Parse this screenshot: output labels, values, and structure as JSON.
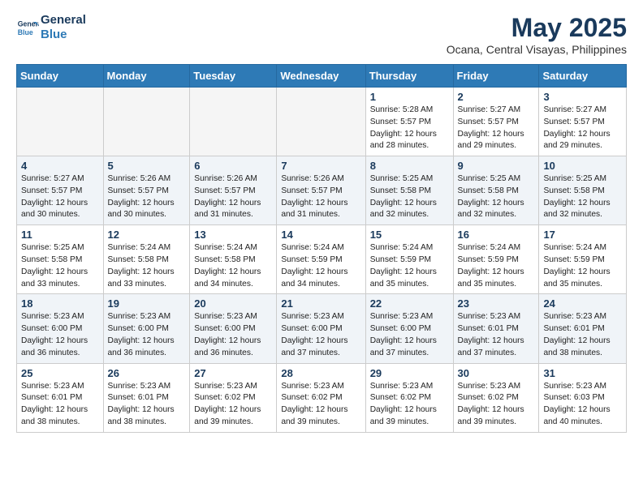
{
  "header": {
    "logo_line1": "General",
    "logo_line2": "Blue",
    "month_title": "May 2025",
    "subtitle": "Ocana, Central Visayas, Philippines"
  },
  "weekdays": [
    "Sunday",
    "Monday",
    "Tuesday",
    "Wednesday",
    "Thursday",
    "Friday",
    "Saturday"
  ],
  "weeks": [
    [
      {
        "day": "",
        "info": ""
      },
      {
        "day": "",
        "info": ""
      },
      {
        "day": "",
        "info": ""
      },
      {
        "day": "",
        "info": ""
      },
      {
        "day": "1",
        "info": "Sunrise: 5:28 AM\nSunset: 5:57 PM\nDaylight: 12 hours\nand 28 minutes."
      },
      {
        "day": "2",
        "info": "Sunrise: 5:27 AM\nSunset: 5:57 PM\nDaylight: 12 hours\nand 29 minutes."
      },
      {
        "day": "3",
        "info": "Sunrise: 5:27 AM\nSunset: 5:57 PM\nDaylight: 12 hours\nand 29 minutes."
      }
    ],
    [
      {
        "day": "4",
        "info": "Sunrise: 5:27 AM\nSunset: 5:57 PM\nDaylight: 12 hours\nand 30 minutes."
      },
      {
        "day": "5",
        "info": "Sunrise: 5:26 AM\nSunset: 5:57 PM\nDaylight: 12 hours\nand 30 minutes."
      },
      {
        "day": "6",
        "info": "Sunrise: 5:26 AM\nSunset: 5:57 PM\nDaylight: 12 hours\nand 31 minutes."
      },
      {
        "day": "7",
        "info": "Sunrise: 5:26 AM\nSunset: 5:57 PM\nDaylight: 12 hours\nand 31 minutes."
      },
      {
        "day": "8",
        "info": "Sunrise: 5:25 AM\nSunset: 5:58 PM\nDaylight: 12 hours\nand 32 minutes."
      },
      {
        "day": "9",
        "info": "Sunrise: 5:25 AM\nSunset: 5:58 PM\nDaylight: 12 hours\nand 32 minutes."
      },
      {
        "day": "10",
        "info": "Sunrise: 5:25 AM\nSunset: 5:58 PM\nDaylight: 12 hours\nand 32 minutes."
      }
    ],
    [
      {
        "day": "11",
        "info": "Sunrise: 5:25 AM\nSunset: 5:58 PM\nDaylight: 12 hours\nand 33 minutes."
      },
      {
        "day": "12",
        "info": "Sunrise: 5:24 AM\nSunset: 5:58 PM\nDaylight: 12 hours\nand 33 minutes."
      },
      {
        "day": "13",
        "info": "Sunrise: 5:24 AM\nSunset: 5:58 PM\nDaylight: 12 hours\nand 34 minutes."
      },
      {
        "day": "14",
        "info": "Sunrise: 5:24 AM\nSunset: 5:59 PM\nDaylight: 12 hours\nand 34 minutes."
      },
      {
        "day": "15",
        "info": "Sunrise: 5:24 AM\nSunset: 5:59 PM\nDaylight: 12 hours\nand 35 minutes."
      },
      {
        "day": "16",
        "info": "Sunrise: 5:24 AM\nSunset: 5:59 PM\nDaylight: 12 hours\nand 35 minutes."
      },
      {
        "day": "17",
        "info": "Sunrise: 5:24 AM\nSunset: 5:59 PM\nDaylight: 12 hours\nand 35 minutes."
      }
    ],
    [
      {
        "day": "18",
        "info": "Sunrise: 5:23 AM\nSunset: 6:00 PM\nDaylight: 12 hours\nand 36 minutes."
      },
      {
        "day": "19",
        "info": "Sunrise: 5:23 AM\nSunset: 6:00 PM\nDaylight: 12 hours\nand 36 minutes."
      },
      {
        "day": "20",
        "info": "Sunrise: 5:23 AM\nSunset: 6:00 PM\nDaylight: 12 hours\nand 36 minutes."
      },
      {
        "day": "21",
        "info": "Sunrise: 5:23 AM\nSunset: 6:00 PM\nDaylight: 12 hours\nand 37 minutes."
      },
      {
        "day": "22",
        "info": "Sunrise: 5:23 AM\nSunset: 6:00 PM\nDaylight: 12 hours\nand 37 minutes."
      },
      {
        "day": "23",
        "info": "Sunrise: 5:23 AM\nSunset: 6:01 PM\nDaylight: 12 hours\nand 37 minutes."
      },
      {
        "day": "24",
        "info": "Sunrise: 5:23 AM\nSunset: 6:01 PM\nDaylight: 12 hours\nand 38 minutes."
      }
    ],
    [
      {
        "day": "25",
        "info": "Sunrise: 5:23 AM\nSunset: 6:01 PM\nDaylight: 12 hours\nand 38 minutes."
      },
      {
        "day": "26",
        "info": "Sunrise: 5:23 AM\nSunset: 6:01 PM\nDaylight: 12 hours\nand 38 minutes."
      },
      {
        "day": "27",
        "info": "Sunrise: 5:23 AM\nSunset: 6:02 PM\nDaylight: 12 hours\nand 39 minutes."
      },
      {
        "day": "28",
        "info": "Sunrise: 5:23 AM\nSunset: 6:02 PM\nDaylight: 12 hours\nand 39 minutes."
      },
      {
        "day": "29",
        "info": "Sunrise: 5:23 AM\nSunset: 6:02 PM\nDaylight: 12 hours\nand 39 minutes."
      },
      {
        "day": "30",
        "info": "Sunrise: 5:23 AM\nSunset: 6:02 PM\nDaylight: 12 hours\nand 39 minutes."
      },
      {
        "day": "31",
        "info": "Sunrise: 5:23 AM\nSunset: 6:03 PM\nDaylight: 12 hours\nand 40 minutes."
      }
    ]
  ]
}
